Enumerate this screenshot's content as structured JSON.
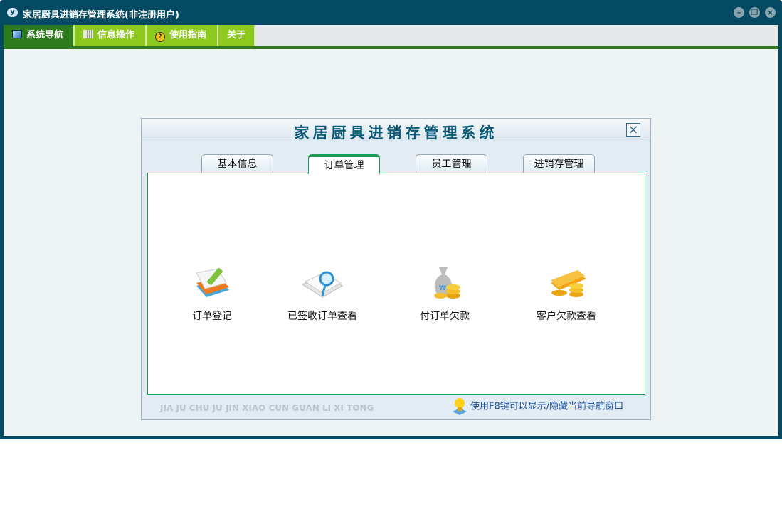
{
  "window": {
    "title": "家居厨具进销存管理系统(非注册用户)",
    "app_icon": "yf-logo",
    "controls": [
      "minimize",
      "restore",
      "close"
    ]
  },
  "menu": [
    {
      "label": "系统导航",
      "icon": "monitor-icon",
      "active": true
    },
    {
      "label": "信息操作",
      "icon": "grid-icon",
      "active": false
    },
    {
      "label": "使用指南",
      "icon": "help-icon",
      "active": false
    },
    {
      "label": "关于",
      "active": false
    }
  ],
  "dialog": {
    "title": "家居厨具进销存管理系统",
    "tabs": [
      {
        "label": "基本信息"
      },
      {
        "label": "订单管理",
        "active": true
      },
      {
        "label": "员工管理"
      },
      {
        "label": "进销存管理"
      }
    ],
    "items": [
      {
        "label": "订单登记",
        "icon": "notepad-pencil-icon"
      },
      {
        "label": "已签收订单查看",
        "icon": "document-magnifier-icon"
      },
      {
        "label": "付订单欠款",
        "icon": "money-bag-coins-icon"
      },
      {
        "label": "客户欠款查看",
        "icon": "card-coins-icon"
      }
    ],
    "footer_pinyin": "JIA JU CHU JU JIN XIAO CUN GUAN LI XI TONG",
    "hint": "使用F8键可以显示/隐藏当前导航窗口"
  }
}
